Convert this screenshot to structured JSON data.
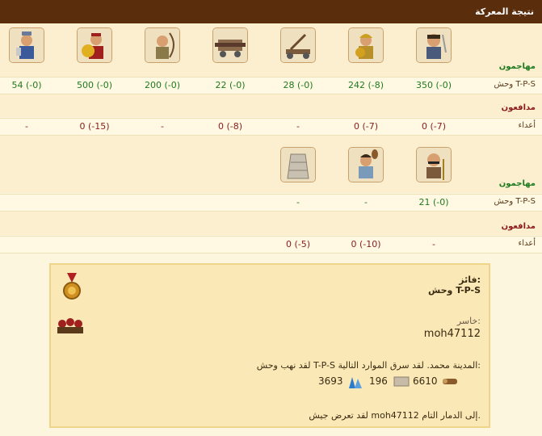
{
  "title": "نتيجة المعركة",
  "battle1": {
    "attackers_label": "مهاجمون",
    "defenders_label": "مدافعون",
    "attacker_row_label": "وحش T-P-S",
    "defender_row_label": "أعداء",
    "units": [
      "sword-warrior-icon",
      "spearman-icon",
      "catapult-icon",
      "ram-icon",
      "archer-icon",
      "shield-warrior-icon",
      "chief-icon"
    ],
    "attacker_values": [
      "350 (-0)",
      "242 (-8)",
      "28 (-0)",
      "22 (-0)",
      "200 (-0)",
      "500 (-0)",
      "54 (-0)"
    ],
    "defender_values": [
      "0 (-7)",
      "0 (-7)",
      "-",
      "0 (-8)",
      "-",
      "0 (-15)",
      "-"
    ]
  },
  "battle2": {
    "attackers_label": "مهاجمون",
    "defenders_label": "مدافعون",
    "attacker_row_label": "وحش T-P-S",
    "defender_row_label": "أعداء",
    "units": [
      "old-man-icon",
      "club-fighter-icon",
      "stone-wall-icon"
    ],
    "attacker_values": [
      "21 (-0)",
      "-",
      "-"
    ],
    "defender_values": [
      "-",
      "0 (-10)",
      "0 (-5)"
    ]
  },
  "report": {
    "winner_label": "فائز:",
    "winner_name": "وحش T-P-S",
    "loser_label": "خاسر:",
    "loser_name": "moh47112",
    "loot_text": "لقد نهب وحش T-P-S المدينة محمد. لقد سرق الموارد التالية:",
    "resources": [
      {
        "icon": "wood-icon",
        "value": "6610"
      },
      {
        "icon": "stone-icon",
        "value": "196"
      },
      {
        "icon": "crystal-icon",
        "value": "3693"
      }
    ],
    "destroy_text": "لقد تعرض جيش moh47112 إلى الدمار التام."
  }
}
